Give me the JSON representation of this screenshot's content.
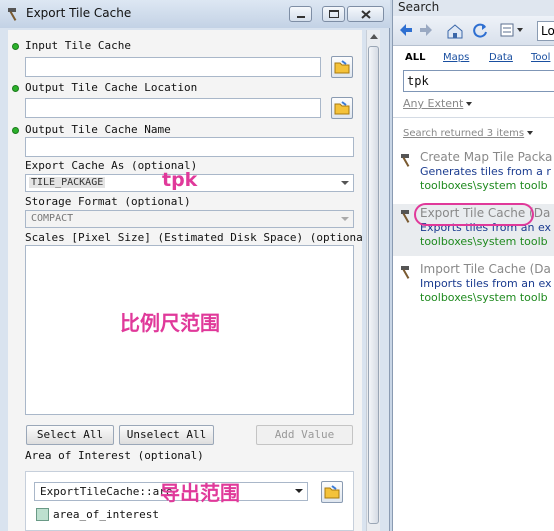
{
  "dialog": {
    "title": "Export Tile Cache",
    "params": {
      "input_tile_cache": "Input Tile Cache",
      "output_location": "Output Tile Cache Location",
      "output_name": "Output Tile Cache Name",
      "export_as_label": "Export Cache As (optional)",
      "export_as_value": "TILE_PACKAGE",
      "storage_format_label": "Storage Format (optional)",
      "storage_format_value": "COMPACT",
      "scales_label": "Scales [Pixel Size] (Estimated Disk Space) (optional)",
      "aoi_label": "Area of Interest (optional)",
      "aoi_value": "ExportTileCache::are",
      "aoi_layer": "area_of_interest"
    },
    "buttons": {
      "select_all": "Select All",
      "unselect_all": "Unselect All",
      "add_value": "Add Value"
    },
    "annotations": {
      "tpk": "tpk",
      "scale_range": "比例尺范围",
      "export_range": "导出范围"
    },
    "colors": {
      "annotation": "#e0399a",
      "required_dot": "#2bb12b"
    }
  },
  "search": {
    "header": "Search",
    "location_button": "Lo",
    "tabs": [
      {
        "label": "ALL",
        "active": true
      },
      {
        "label": "Maps",
        "active": false
      },
      {
        "label": "Data",
        "active": false
      },
      {
        "label": "Tool",
        "active": false
      }
    ],
    "query": "tpk",
    "extent": "Any Extent",
    "count": "Search returned 3 items",
    "results": [
      {
        "title": "Create Map Tile Packa",
        "desc": "Generates tiles from a r",
        "path": "toolboxes\\system toolb"
      },
      {
        "title": "Export Tile Cache (Da",
        "desc": "Exports tiles from an ex",
        "path": "toolboxes\\system toolb"
      },
      {
        "title": "Import Tile Cache (Da",
        "desc": "Imports tiles from an ex",
        "path": "toolboxes\\system toolb"
      }
    ]
  }
}
